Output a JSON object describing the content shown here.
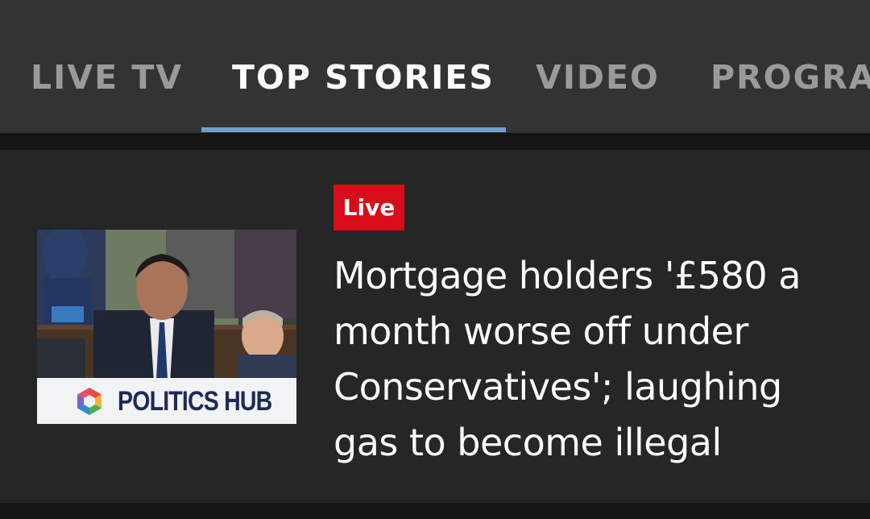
{
  "nav": {
    "tabs": [
      {
        "label": "LIVE TV",
        "active": false
      },
      {
        "label": "TOP STORIES",
        "active": true
      },
      {
        "label": "VIDEO",
        "active": false
      },
      {
        "label": "PROGRAMMES",
        "active": false
      }
    ]
  },
  "story": {
    "badge": "Live",
    "headline": "Mortgage holders '£580 a month worse off under Conservatives'; laughing gas to become illegal",
    "thumbnail": {
      "overlay_text": "POLITICS HUB",
      "logo_icon": "politics-hub-hexagon-icon"
    }
  },
  "colors": {
    "nav_bg": "#333333",
    "card_bg": "#262626",
    "active_underline": "#6f9fcf",
    "live_badge": "#d80d1a"
  }
}
